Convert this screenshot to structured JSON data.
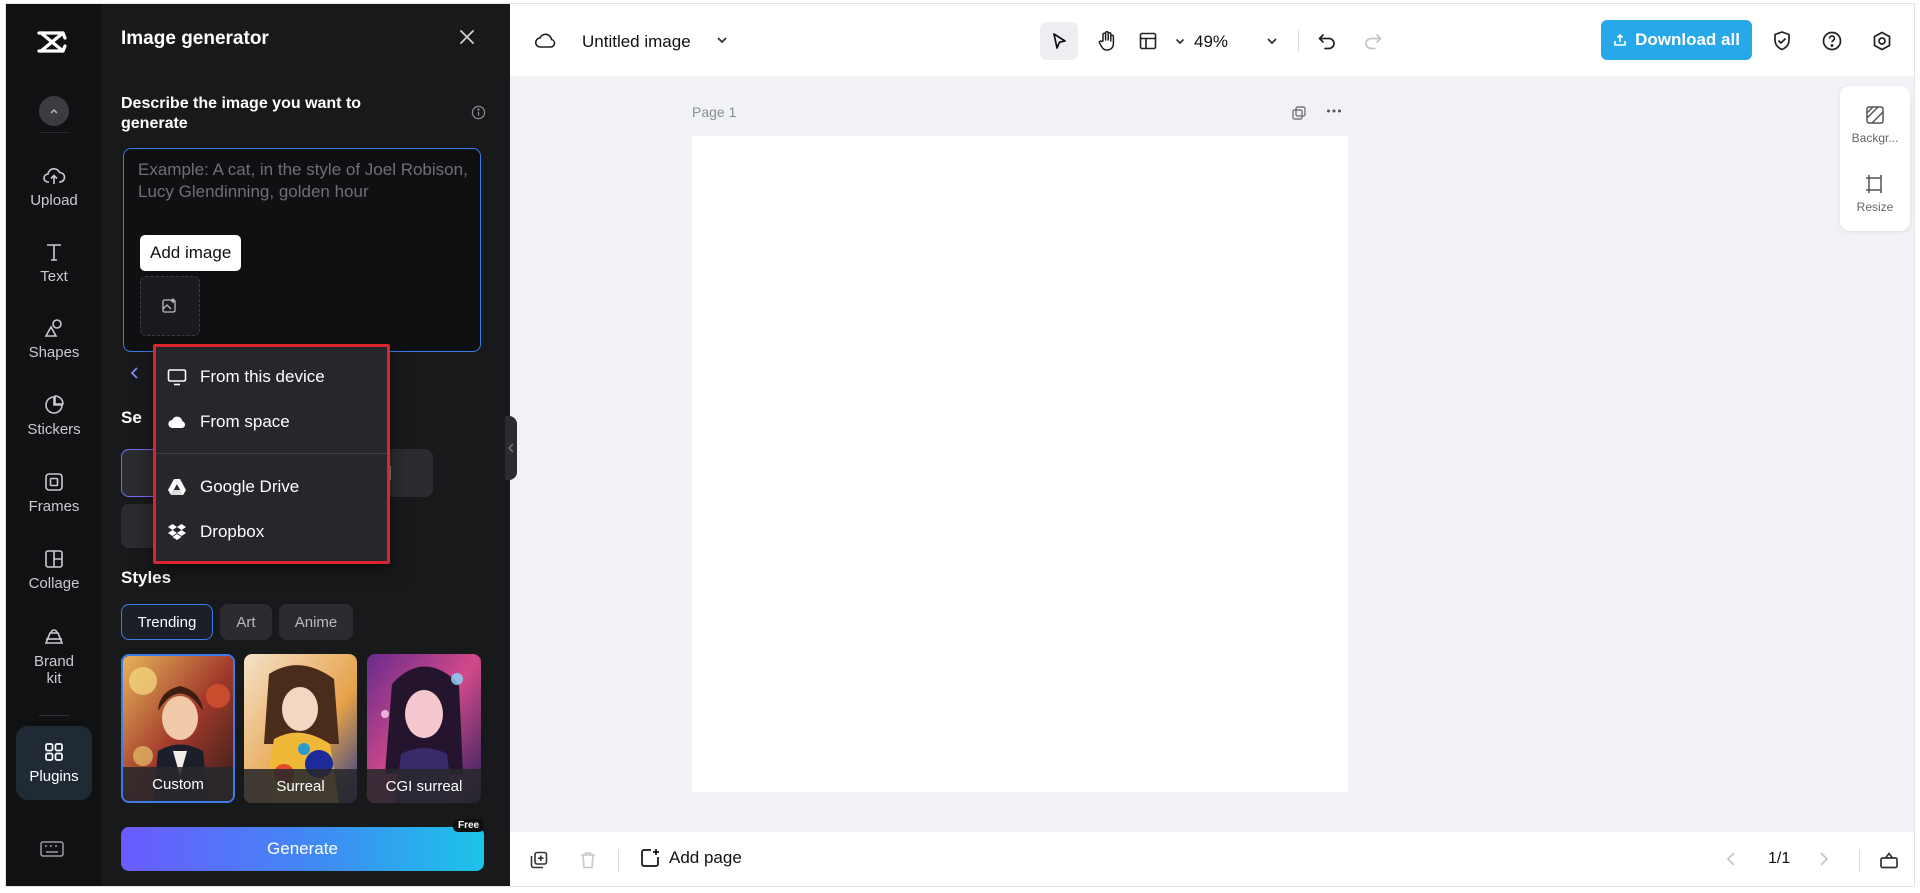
{
  "rail": {
    "items": [
      {
        "label": "Upload",
        "icon": "upload-cloud-icon"
      },
      {
        "label": "Text",
        "icon": "text-icon"
      },
      {
        "label": "Shapes",
        "icon": "shapes-icon"
      },
      {
        "label": "Stickers",
        "icon": "sticker-icon"
      },
      {
        "label": "Frames",
        "icon": "frame-icon"
      },
      {
        "label": "Collage",
        "icon": "collage-icon"
      },
      {
        "label": "Brand kit",
        "icon": "brand-kit-icon"
      },
      {
        "label": "Plugins",
        "icon": "plugins-grid-icon"
      }
    ]
  },
  "panel": {
    "title": "Image generator",
    "prompt_label": "Describe the image you want to generate",
    "prompt_placeholder": "Example: A cat, in the style of Joel Robison, Lucy Glendinning, golden hour",
    "add_image_label": "Add image",
    "section_partial": "Se",
    "styles_label": "Styles",
    "style_tabs": [
      "Trending",
      "Art",
      "Anime"
    ],
    "style_cards": [
      "Custom",
      "Surreal",
      "CGI surreal"
    ],
    "generate_label": "Generate",
    "free_badge": "Free"
  },
  "upload_menu": {
    "items": [
      {
        "label": "From this device",
        "icon": "monitor-icon"
      },
      {
        "label": "From space",
        "icon": "cloud-icon"
      },
      {
        "label": "Google Drive",
        "icon": "google-drive-icon"
      },
      {
        "label": "Dropbox",
        "icon": "dropbox-icon"
      }
    ]
  },
  "topbar": {
    "doc_title": "Untitled image",
    "zoom": "49%",
    "download_label": "Download all"
  },
  "canvas": {
    "page_label": "Page 1"
  },
  "side_tools": {
    "background_label": "Backgr...",
    "resize_label": "Resize"
  },
  "bottombar": {
    "add_page_label": "Add page",
    "pager": "1/1"
  },
  "colors": {
    "accent_blue": "#27a8e9",
    "selection_blue": "#3d7be6",
    "highlight_red": "#d9262c",
    "panel_bg": "#18191b",
    "rail_bg": "#101113"
  }
}
